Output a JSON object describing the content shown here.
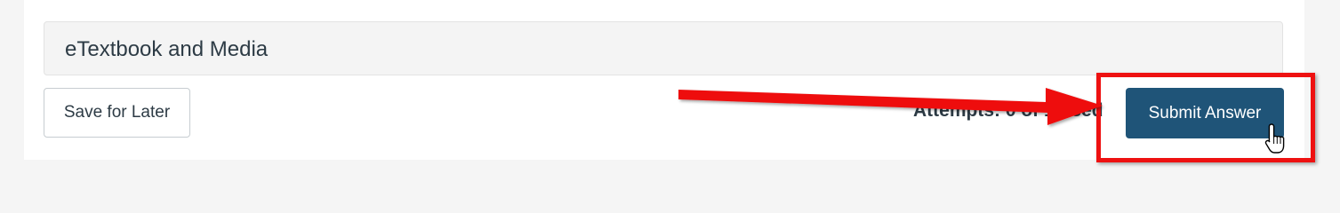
{
  "etextbook": {
    "title": "eTextbook and Media"
  },
  "actions": {
    "save_label": "Save for Later",
    "submit_label": "Submit Answer"
  },
  "attempts": {
    "text": "Attempts: 0 of 1 used"
  },
  "annotation": {
    "arrow_icon": "arrow-right-icon",
    "cursor_icon": "hand-pointer-icon",
    "highlight_color": "#ee1111"
  },
  "colors": {
    "submit_background": "#1f5478",
    "text": "#2d3b45"
  }
}
